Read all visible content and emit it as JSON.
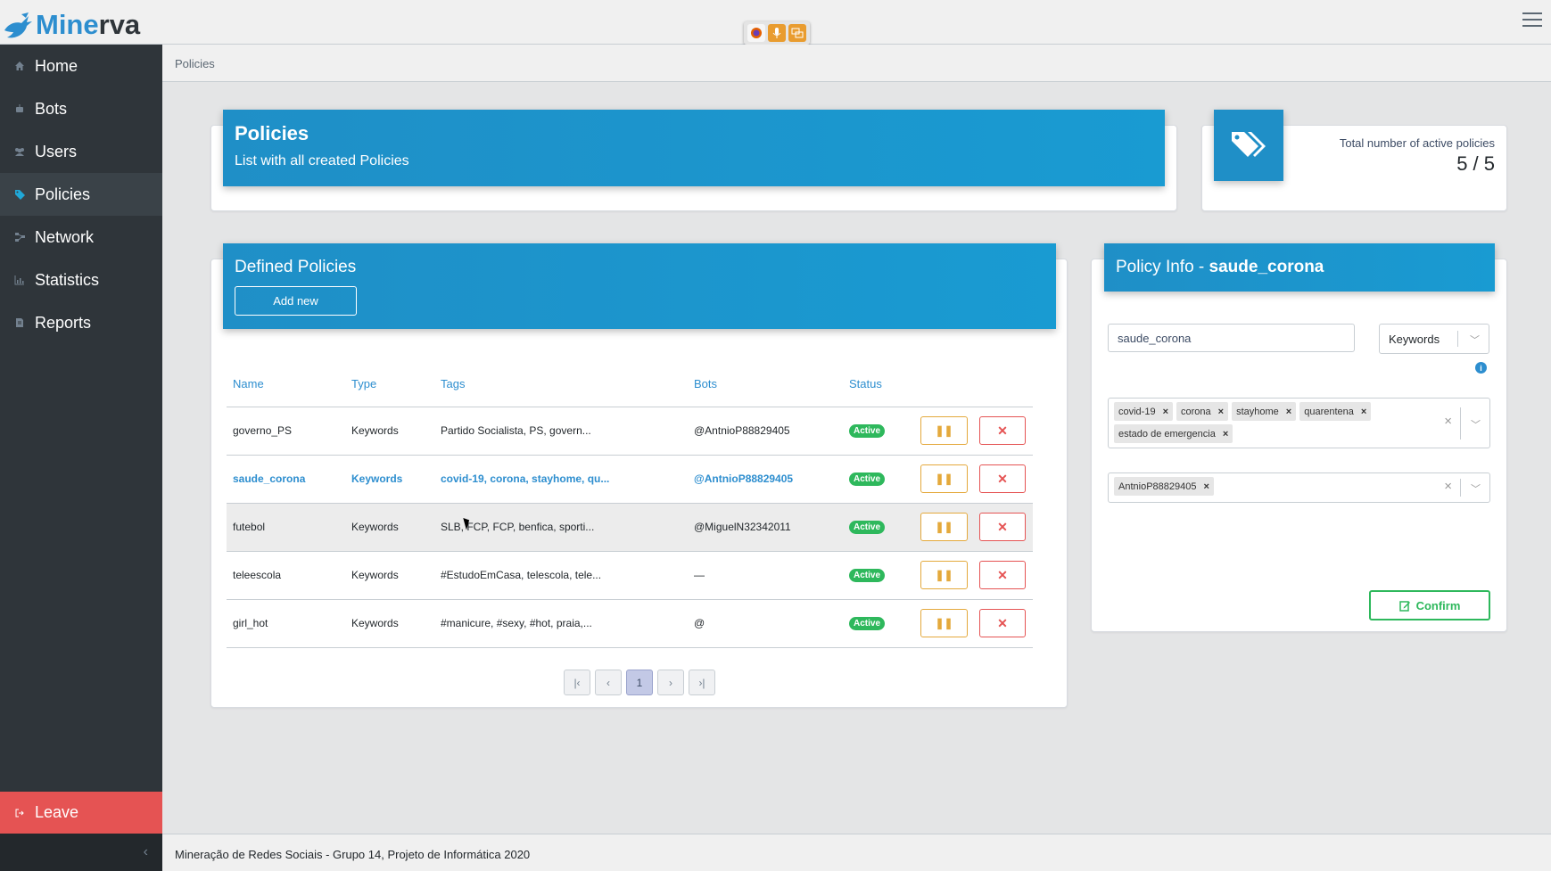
{
  "app": {
    "logo_part1": "Mine",
    "logo_part2": "rva"
  },
  "sidebar": {
    "items": [
      {
        "label": "Home",
        "icon": "home-icon"
      },
      {
        "label": "Bots",
        "icon": "robot-icon"
      },
      {
        "label": "Users",
        "icon": "users-icon"
      },
      {
        "label": "Policies",
        "icon": "tags-icon",
        "active": true
      },
      {
        "label": "Network",
        "icon": "network-icon"
      },
      {
        "label": "Statistics",
        "icon": "chart-icon"
      },
      {
        "label": "Reports",
        "icon": "file-icon"
      }
    ],
    "leave_label": "Leave",
    "collapse_glyph": "‹"
  },
  "breadcrumb": "Policies",
  "policies_header": {
    "title": "Policies",
    "subtitle": "List with all created Policies"
  },
  "active_count": {
    "label": "Total number of active policies",
    "value": "5 / 5"
  },
  "defined": {
    "title": "Defined Policies",
    "add_label": "Add new",
    "columns": [
      "Name",
      "Type",
      "Tags",
      "Bots",
      "Status"
    ],
    "rows": [
      {
        "name": "governo_PS",
        "type": "Keywords",
        "tags": "Partido Socialista, PS, govern...",
        "bots": "@AntnioP88829405",
        "status": "Active"
      },
      {
        "name": "saude_corona",
        "type": "Keywords",
        "tags": "covid-19, corona, stayhome, qu...",
        "bots": "@AntnioP88829405",
        "status": "Active"
      },
      {
        "name": "futebol",
        "type": "Keywords",
        "tags": "SLB, FCP, FCP, benfica, sporti...",
        "bots": "@MiguelN32342011",
        "status": "Active"
      },
      {
        "name": "teleescola",
        "type": "Keywords",
        "tags": "#EstudoEmCasa, telescola, tele...",
        "bots": "—",
        "status": "Active"
      },
      {
        "name": "girl_hot",
        "type": "Keywords",
        "tags": "#manicure, #sexy, #hot, praia,...",
        "bots": "@",
        "status": "Active"
      }
    ],
    "pagination": {
      "first": "|‹",
      "prev": "‹",
      "current": "1",
      "next": "›",
      "last": "›|"
    }
  },
  "policy_info": {
    "title_prefix": "Policy Info - ",
    "title_name": "saude_corona",
    "name_value": "saude_corona",
    "type_value": "Keywords",
    "tags": [
      "covid-19",
      "corona",
      "stayhome",
      "quarentena",
      "estado de emergencia"
    ],
    "bots": [
      "AntnioP88829405"
    ],
    "confirm_label": "Confirm"
  },
  "footer": "Mineração de Redes Sociais - Grupo 14, Projeto de Informática 2020",
  "colors": {
    "accent": "#1f8fc7",
    "sidebar": "#2f353a",
    "success": "#2eb85c",
    "danger": "#e55353",
    "warning": "#e4a93c"
  }
}
